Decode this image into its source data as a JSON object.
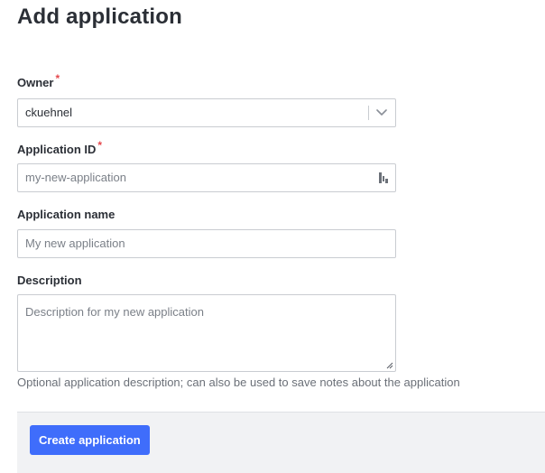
{
  "page": {
    "title": "Add application"
  },
  "form": {
    "owner": {
      "label": "Owner",
      "required_mark": "*",
      "value": "ckuehnel"
    },
    "application_id": {
      "label": "Application ID",
      "required_mark": "*",
      "placeholder": "my-new-application"
    },
    "application_name": {
      "label": "Application name",
      "placeholder": "My new application"
    },
    "description": {
      "label": "Description",
      "placeholder": "Description for my new application",
      "help": "Optional application description; can also be used to save notes about the application"
    }
  },
  "footer": {
    "submit_label": "Create application"
  },
  "colors": {
    "accent": "#3f6dfb",
    "required": "#e5484d"
  },
  "icons": {
    "owner_select": "chevron-down-icon",
    "application_id_generate": "id-generate-icon",
    "description_resize": "resize-grip-icon"
  }
}
